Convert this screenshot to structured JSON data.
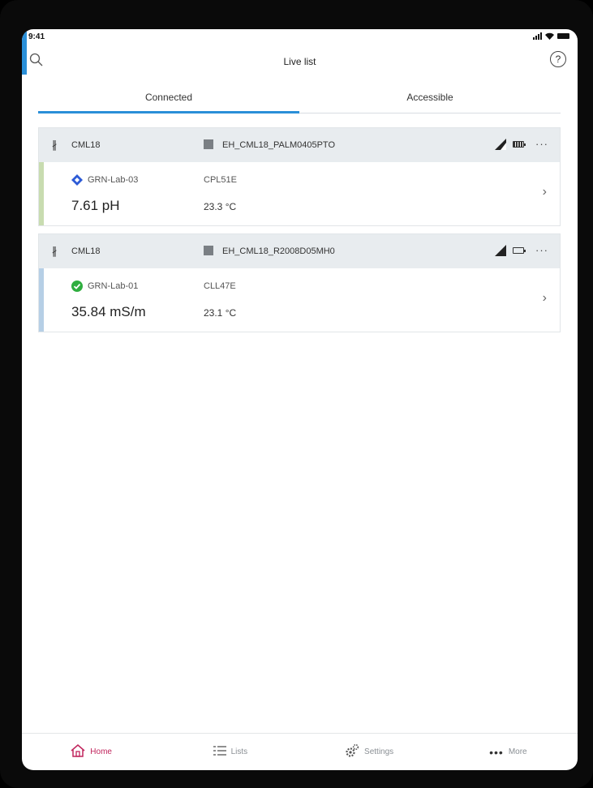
{
  "status": {
    "time": "9:41"
  },
  "header": {
    "title": "Live list",
    "help_label": "?"
  },
  "tabs": [
    {
      "label": "Connected",
      "active": true
    },
    {
      "label": "Accessible",
      "active": false
    }
  ],
  "cards": [
    {
      "device": "CML18",
      "tag": "EH_CML18_PALM0405PTO",
      "location": "GRN-Lab-03",
      "location_status": "diamond-status-icon",
      "status_color": "#2d5bd6",
      "sensor": "CPL51E",
      "value": "7.61 pH",
      "temperature": "23.3 °C",
      "stripe_color": "#c8dcb0",
      "battery": "full"
    },
    {
      "device": "CML18",
      "tag": "EH_CML18_R2008D05MH0",
      "location": "GRN-Lab-01",
      "location_status": "check-status-icon",
      "status_color": "#2fae3f",
      "sensor": "CLL47E",
      "value": "35.84 mS/m",
      "temperature": "23.1 °C",
      "stripe_color": "#b6cfe6",
      "battery": "low"
    }
  ],
  "nav": [
    {
      "label": "Home",
      "icon": "home-icon",
      "active": true
    },
    {
      "label": "Lists",
      "icon": "list-icon",
      "active": false
    },
    {
      "label": "Settings",
      "icon": "gear-icon",
      "active": false
    },
    {
      "label": "More",
      "icon": "more-dots-icon",
      "active": false
    }
  ],
  "colors": {
    "accent": "#2a8fd8",
    "nav_active": "#c0245c"
  }
}
